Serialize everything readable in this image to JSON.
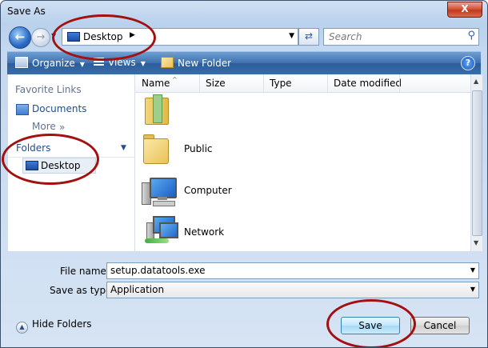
{
  "window": {
    "title": "Save As",
    "close_label": "X"
  },
  "nav": {
    "address": "Desktop",
    "search_placeholder": "Search"
  },
  "toolbar": {
    "organize": "Organize",
    "views": "Views",
    "new_folder": "New Folder",
    "help": "?"
  },
  "left_pane": {
    "favorite_links": "Favorite Links",
    "documents": "Documents",
    "more": "More",
    "more_chevron": "»",
    "folders": "Folders",
    "desktop": "Desktop"
  },
  "columns": {
    "name": "Name",
    "size": "Size",
    "type": "Type",
    "date_modified": "Date modified"
  },
  "items": [
    {
      "label": "",
      "icon": "user-folder-icon"
    },
    {
      "label": "Public",
      "icon": "folder-icon"
    },
    {
      "label": "Computer",
      "icon": "computer-icon"
    },
    {
      "label": "Network",
      "icon": "network-icon"
    }
  ],
  "form": {
    "file_name_label": "File name:",
    "file_name_value": "setup.datatools.exe",
    "save_as_type_label": "Save as type:",
    "save_as_type_value": "Application"
  },
  "footer": {
    "hide_folders": "Hide Folders",
    "save": "Save",
    "cancel": "Cancel"
  },
  "colors": {
    "annotation_ellipse": "#a31010",
    "toolbar": "#3f70ad",
    "link": "#1f4d8f"
  }
}
